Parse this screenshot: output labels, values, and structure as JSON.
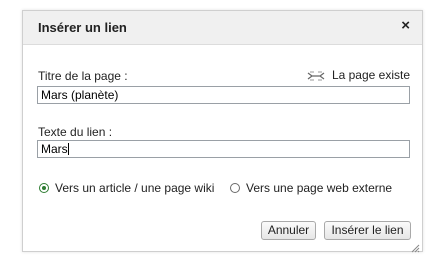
{
  "dialog": {
    "title": "Insérer un lien",
    "close_label": "×",
    "page_title_label": "Titre de la page :",
    "page_exists": {
      "icon": "link-exists-icon",
      "label": "La page existe"
    },
    "page_title_value": "Mars (planète)",
    "link_text_label": "Texte du lien :",
    "link_text_value": "Mars",
    "radio_wiki": {
      "label": "Vers un article / une page wiki",
      "selected": true
    },
    "radio_web": {
      "label": "Vers une page web externe",
      "selected": false
    },
    "cancel_label": "Annuler",
    "insert_label": "Insérer le lien"
  },
  "colors": {
    "accent": "#2e7d32",
    "titlebar_bg": "#f0f0f0"
  }
}
